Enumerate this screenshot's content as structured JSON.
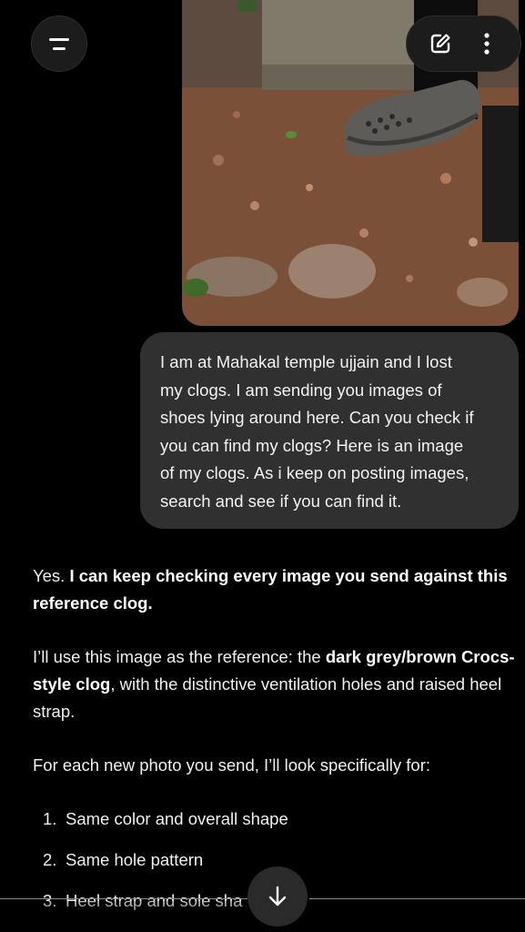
{
  "header": {
    "menu_icon": "menu-icon",
    "edit_icon": "new-chat-edit-icon",
    "more_icon": "more-vertical-icon"
  },
  "attachment": {
    "alt": "reference-photo-of-clog"
  },
  "user_message": {
    "lines": [
      "I am at Mahakal temple ujjain and I lost",
      "my clogs. I am sending you images of",
      "shoes lying around here. Can you check if",
      "you can find my clogs? Here is an image",
      "of my clogs. As i keep on posting images,",
      "search and see if you can find it."
    ]
  },
  "assistant_message": {
    "p1_plain": "Yes. ",
    "p1_bold": "I can keep checking every image you send against this reference clog.",
    "p2_plain1": "I’ll use this image as the reference: the ",
    "p2_bold": "dark grey/brown Crocs-style clog",
    "p2_plain2": ", with the distinctive ventilation holes and raised heel strap.",
    "p3": "For each new photo you send, I’ll look specifically for:",
    "list": [
      {
        "num": "1.",
        "text": "Same color and overall shape"
      },
      {
        "num": "2.",
        "text": "Same hole pattern"
      },
      {
        "num": "3.",
        "text": "Heel strap and sole sha"
      }
    ]
  },
  "scroll_down_icon": "arrow-down-icon",
  "colors": {
    "background": "#000000",
    "bubble": "#303030",
    "button": "#1c1c1c",
    "text": "#ffffff"
  }
}
